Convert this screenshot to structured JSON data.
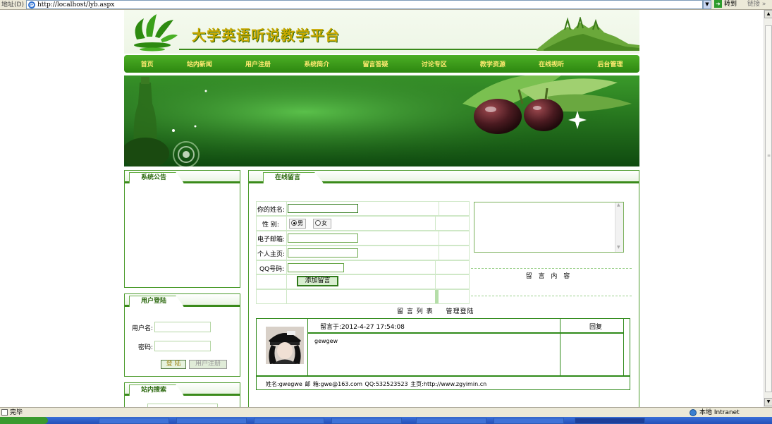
{
  "browser": {
    "address_label": "地址(D)",
    "url": "http://localhost/lyb.aspx",
    "go_label": "转到",
    "links_label": "链接 »",
    "status": "完毕",
    "zone": "本地 Intranet"
  },
  "site": {
    "title": "大学英语听说教学平台",
    "nav": [
      "首页",
      "站内新闻",
      "用户注册",
      "系统简介",
      "留言答疑",
      "讨论专区",
      "教学资源",
      "在线视听",
      "后台管理"
    ]
  },
  "sidebar": {
    "notice_title": "系统公告",
    "login_title": "用户登陆",
    "username_label": "用户名:",
    "password_label": "密码:",
    "login_button": "登 陆",
    "register_button": "用户注册",
    "search_title": "站内搜索"
  },
  "main": {
    "title": "在线留言",
    "form": {
      "name_label": "你的姓名:",
      "gender_label": "性 别:",
      "male": "男",
      "female": "女",
      "email_label": "电子邮箱:",
      "homepage_label": "个人主页:",
      "qq_label": "QQ号码:",
      "submit": "添加留言",
      "content_caption": "留 言 内 容"
    },
    "list": {
      "heading": "留 言 列 表",
      "admin_link": "管理登陆",
      "time": "留言于:2012-4-27 17:54:08",
      "reply": "回复",
      "body": "gewgew",
      "footer": "姓名:gwegwe    邮 箱:gwe@163.com    QQ:532523523    主页:http://www.zgyimin.cn"
    }
  },
  "colors": {
    "brand_green": "#3a8a1a",
    "nav_text": "#ffea70",
    "title_gold": "#c8a800"
  }
}
